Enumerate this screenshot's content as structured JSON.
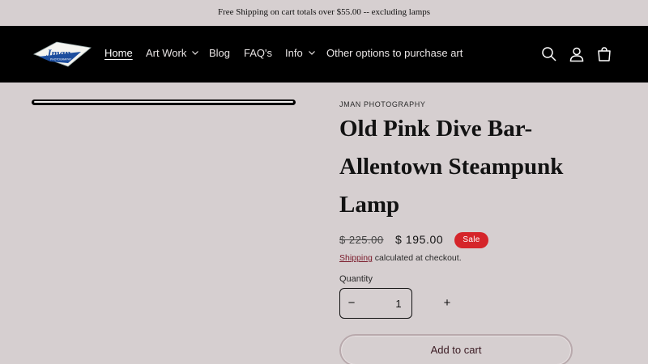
{
  "announcement": "Free Shipping on cart totals over $55.00 -- excluding lamps",
  "header": {
    "logo_text": "Jman",
    "logo_subtext": "PHOTOGRAPHY",
    "nav": [
      {
        "label": "Home",
        "active": true,
        "dropdown": false
      },
      {
        "label": "Art Work",
        "active": false,
        "dropdown": true
      },
      {
        "label": "Blog",
        "active": false,
        "dropdown": false
      },
      {
        "label": "FAQ's",
        "active": false,
        "dropdown": false
      },
      {
        "label": "Info",
        "active": false,
        "dropdown": true
      },
      {
        "label": "Other options to purchase art",
        "active": false,
        "dropdown": false
      }
    ],
    "icons": [
      "search-icon",
      "account-icon",
      "cart-icon"
    ]
  },
  "product": {
    "vendor": "JMAN PHOTOGRAPHY",
    "title": "Old Pink Dive Bar- Allentown Steampunk Lamp",
    "price_regular": "$ 225.00",
    "price_sale": "$ 195.00",
    "badge": "Sale",
    "shipping_link": "Shipping",
    "shipping_text": " calculated at checkout.",
    "quantity_label": "Quantity",
    "quantity_value": "1",
    "minus_label": "−",
    "plus_label": "+",
    "add_to_cart": "Add to cart"
  },
  "colors": {
    "background": "#d6cfd0",
    "header": "#000000",
    "sale_badge": "#d5252a",
    "link": "#7a1a2a"
  }
}
